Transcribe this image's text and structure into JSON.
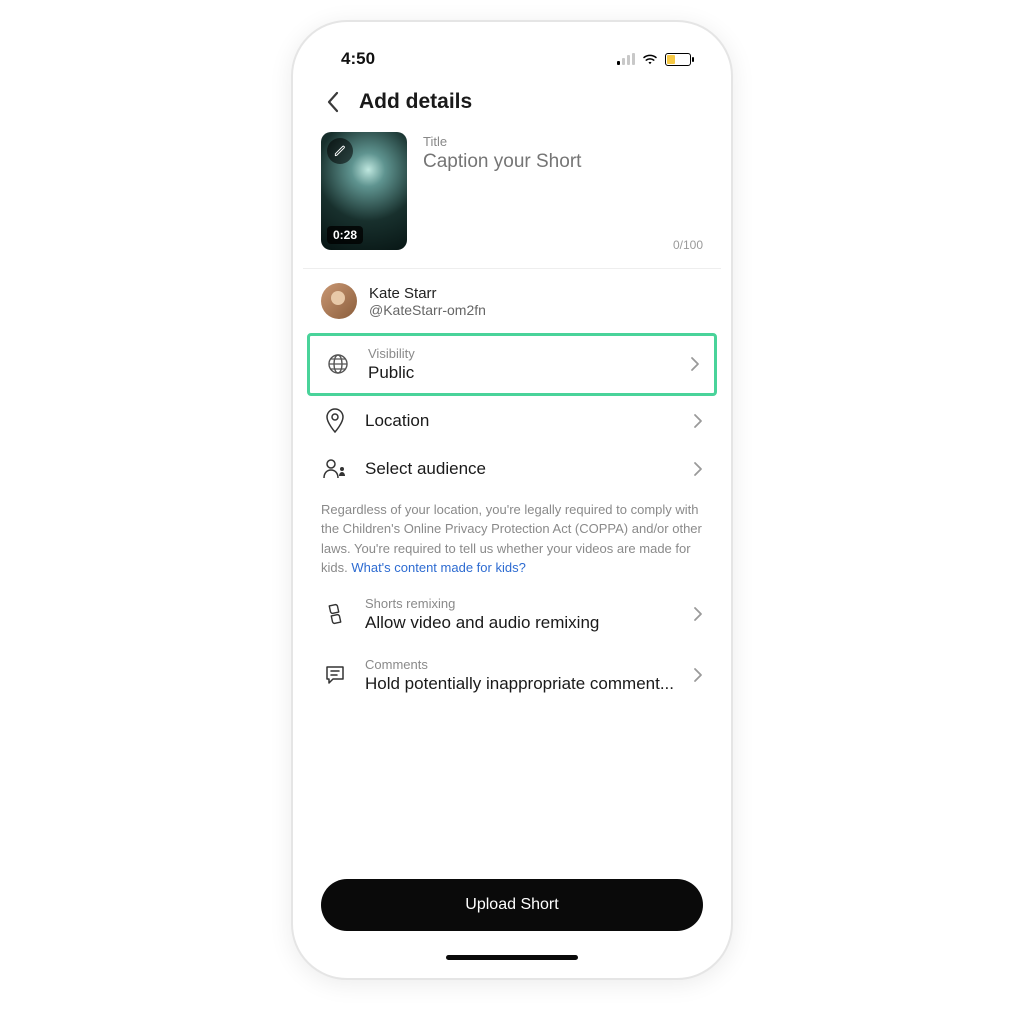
{
  "status": {
    "time": "4:50"
  },
  "header": {
    "title": "Add details"
  },
  "caption": {
    "label": "Title",
    "placeholder": "Caption your Short",
    "duration": "0:28",
    "count": "0/100"
  },
  "user": {
    "name": "Kate Starr",
    "handle": "@KateStarr-om2fn"
  },
  "visibility": {
    "label": "Visibility",
    "value": "Public"
  },
  "location": {
    "value": "Location"
  },
  "audience": {
    "value": "Select audience"
  },
  "legal": {
    "text": "Regardless of your location, you're legally required to comply with the Children's Online Privacy Protection Act (COPPA) and/or other laws. You're required to tell us whether your videos are made for kids. ",
    "link": "What's content made for kids?"
  },
  "remix": {
    "label": "Shorts remixing",
    "value": "Allow video and audio remixing"
  },
  "comments": {
    "label": "Comments",
    "value": "Hold potentially inappropriate comment..."
  },
  "footer": {
    "button": "Upload Short"
  }
}
